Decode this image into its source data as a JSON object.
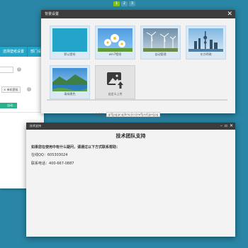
{
  "pager": {
    "pages": [
      "1",
      "2",
      "3"
    ],
    "current": 0
  },
  "settings_window": {
    "tabs": [
      "选择壁纸设置",
      "部门设"
    ],
    "tag_label": "单机壁纸",
    "radio_label": "自动..."
  },
  "picker": {
    "title": "背景设置",
    "tiles": [
      {
        "label": "默认壁纸",
        "icon": "blank-wallpaper-icon"
      },
      {
        "label": "win7壁纸",
        "icon": "daisy-photo-icon"
      },
      {
        "label": "自动管理",
        "icon": "wind-turbines-photo-icon"
      },
      {
        "label": "东方明珠",
        "icon": "city-skyline-photo-icon"
      },
      {
        "label": "青绿景色",
        "icon": "lake-scenery-photo-icon"
      },
      {
        "label": "自定义上传",
        "icon": "upload-image-icon"
      }
    ],
    "field_label": "上传类型",
    "field_value": "gif|jpg|png|bmp|ico|swf|psd|jpe|jpg"
  },
  "support": {
    "title": "技术支持",
    "heading": "技术团队支持",
    "intro": "如果您在使用中有什么疑问，请通过以下方式联系帮助：",
    "qq_label": "在线QQ：",
    "qq_value": "605303024",
    "phone_label": "联系电话：",
    "phone_value": "400-667-0887"
  }
}
